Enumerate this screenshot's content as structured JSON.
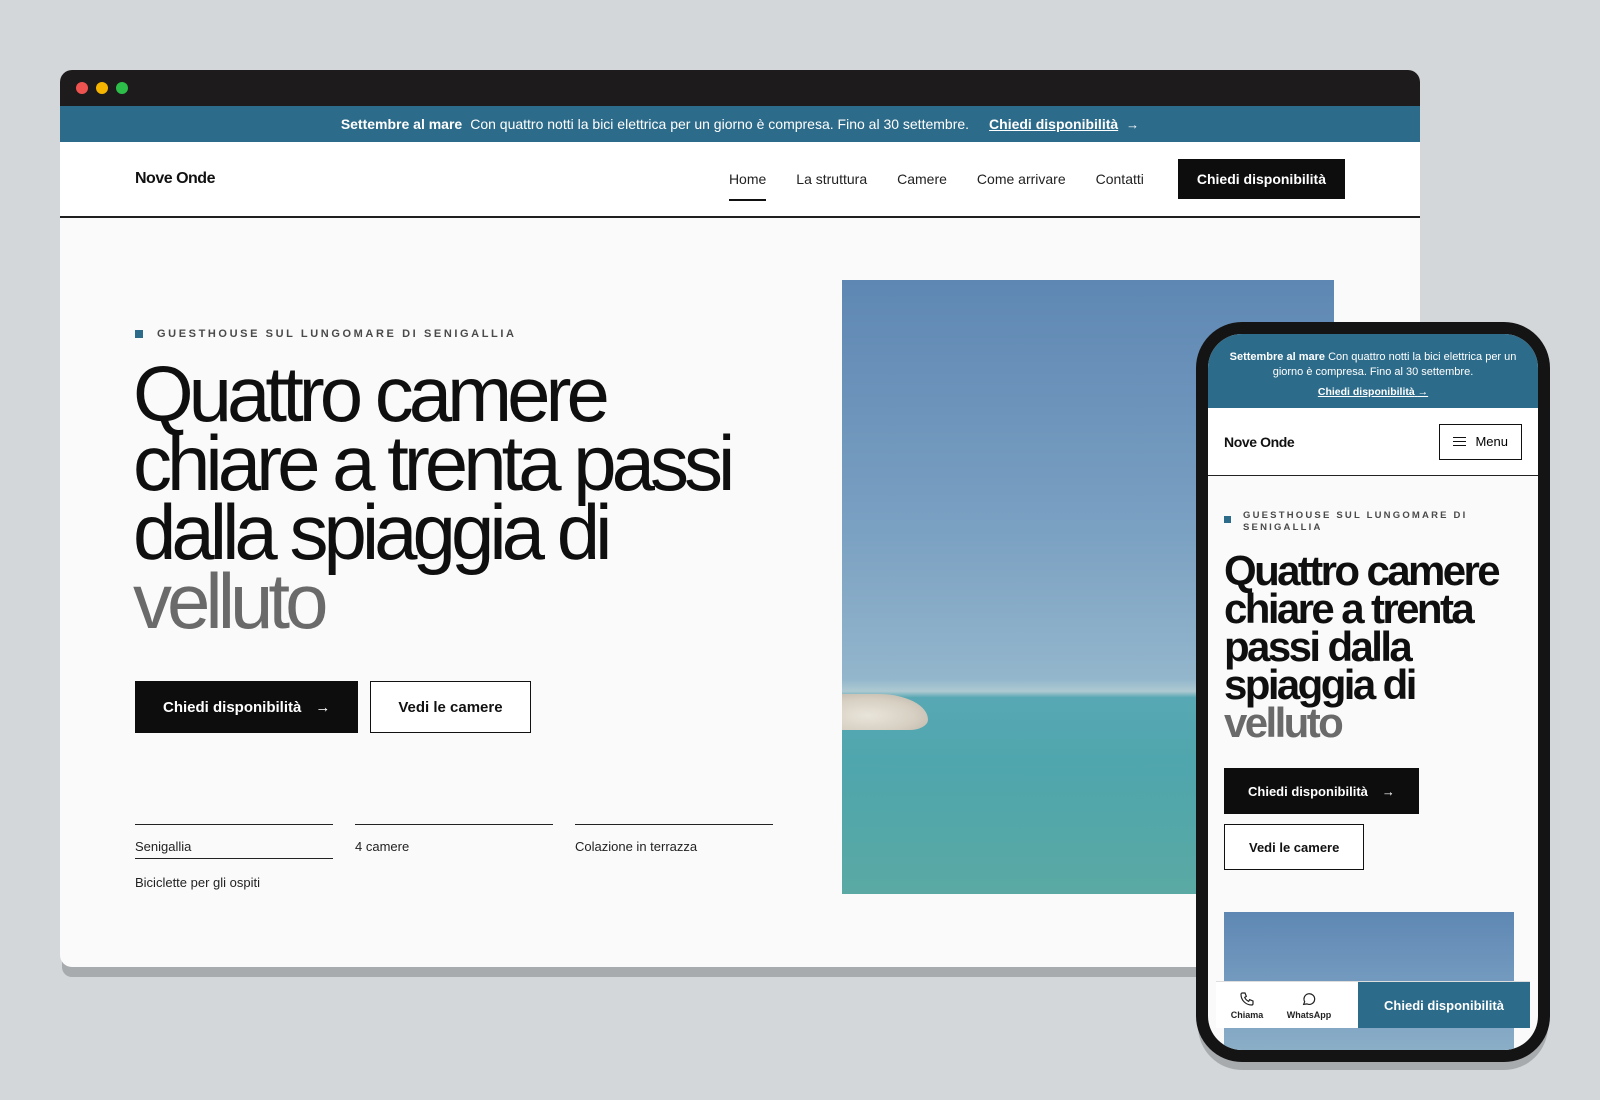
{
  "promo": {
    "strong": "Settembre al mare",
    "text": "Con quattro notti la bici elettrica per un giorno è compresa. Fino al 30 settembre.",
    "link": "Chiedi disponibilità",
    "arrow": "→"
  },
  "nav": {
    "logo": "Nove Onde",
    "links": [
      "Home",
      "La struttura",
      "Camere",
      "Come arrivare",
      "Contatti"
    ],
    "cta": "Chiedi disponibilità"
  },
  "hero": {
    "eyebrow": "GUESTHOUSE SUL LUNGOMARE DI SENIGALLIA",
    "headline_main": "Quattro camere chiare a trenta passi dalla spiaggia di ",
    "headline_accent": "velluto",
    "primary_button": "Chiedi disponibilità",
    "primary_arrow": "→",
    "secondary_button": "Vedi le camere",
    "facts": [
      "Senigallia",
      "4 camere",
      "Colazione in terrazza"
    ],
    "fact_extra": "Biciclette per gli ospiti"
  },
  "mobile": {
    "eyebrow": "GUESTHOUSE SUL LUNGOMARE DI SENIGALLIA",
    "menu": "Menu",
    "bottom_bar": {
      "call": "Chiama",
      "whatsapp": "WhatsApp",
      "cta": "Chiedi disponibilità"
    }
  },
  "icons": {
    "arrow": "arrow-right-icon",
    "phone": "phone-icon",
    "whatsapp": "whatsapp-icon",
    "menu": "hamburger-menu-icon"
  },
  "colors": {
    "accent": "#2d6b8a",
    "dark": "#0d0d0d"
  }
}
